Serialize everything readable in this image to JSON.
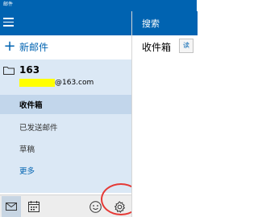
{
  "window": {
    "title": "邮件"
  },
  "left_pane": {
    "new_mail_label": "新邮件",
    "account": {
      "name": "163",
      "email_suffix": "@163.com"
    },
    "folders": [
      {
        "label": "收件箱",
        "selected": true
      },
      {
        "label": "已发送邮件",
        "selected": false
      },
      {
        "label": "草稿",
        "selected": false
      },
      {
        "label": "更多",
        "selected": false
      }
    ],
    "bottom_bar": {
      "icons": [
        "mail-icon",
        "calendar-icon",
        "smiley-icon",
        "gear-icon"
      ]
    }
  },
  "right_pane": {
    "search_label": "搜索",
    "inbox_title": "收件箱",
    "read_tag": "读"
  },
  "colors": {
    "accent": "#0063b1",
    "highlight_circle": "#e53935",
    "redaction": "#ffff00"
  }
}
